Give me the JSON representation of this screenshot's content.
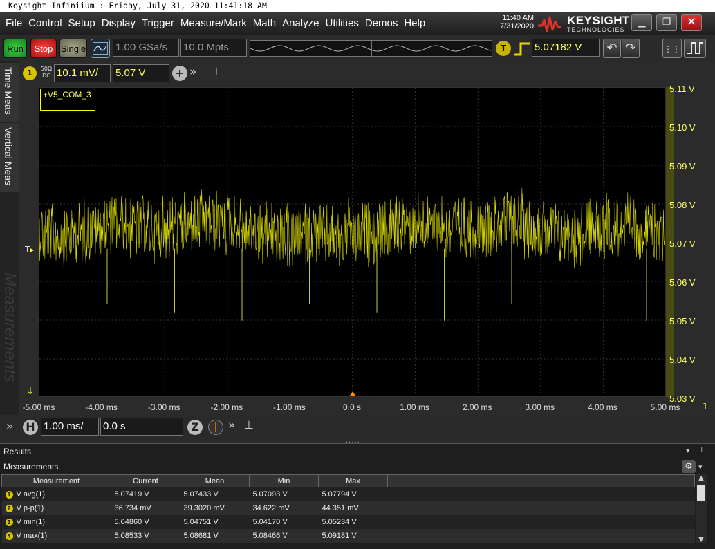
{
  "title_bar": {
    "text": "Keysight Infiniium : Friday, July 31, 2020 11:41:18 AM"
  },
  "menu": [
    "File",
    "Control",
    "Setup",
    "Display",
    "Trigger",
    "Measure/Mark",
    "Math",
    "Analyze",
    "Utilities",
    "Demos",
    "Help"
  ],
  "datetime": {
    "time": "11:40 AM",
    "date": "7/31/2020"
  },
  "brand": {
    "name": "KEYSIGHT",
    "sub": "TECHNOLOGIES"
  },
  "toolbar": {
    "run_label": "Run",
    "stop_label": "Stop",
    "single_label": "Single",
    "sample_rate": "1.00 GSa/s",
    "memory_depth": "10.0 Mpts",
    "trigger_badge": "T",
    "trigger_level": "5.07182 V"
  },
  "side_tabs": [
    "Time Meas",
    "Vertical Meas",
    "Measurements"
  ],
  "channel": {
    "number": "1",
    "impedance": "50Ω",
    "coupling": "DC",
    "scale": "10.1 mV/",
    "offset": "5.07 V",
    "label": "+V5_COM_3"
  },
  "horizontal": {
    "badge": "H",
    "scale": "1.00 ms/",
    "position": "0.0 s",
    "zoom_badge": "Z"
  },
  "markers": {
    "trigger": "T",
    "ground": "↓",
    "channel_index": "1"
  },
  "chart_data": {
    "type": "line",
    "y_tick_labels": [
      "5.11 V",
      "5.10 V",
      "5.09 V",
      "5.08 V",
      "5.07 V",
      "5.06 V",
      "5.05 V",
      "5.04 V",
      "5.03 V"
    ],
    "x_tick_labels": [
      "-5.00 ms",
      "-4.00 ms",
      "-3.00 ms",
      "-2.00 ms",
      "-1.00 ms",
      "0.0 s",
      "1.00 ms",
      "2.00 ms",
      "3.00 ms",
      "4.00 ms",
      "5.00 ms"
    ],
    "xlim": [
      -0.005,
      0.005
    ],
    "ylim": [
      5.0305,
      5.1105
    ],
    "grid": true,
    "trace_color": "#ffff00",
    "series": [
      {
        "mean_level": 5.0743,
        "band_min": 5.0647,
        "band_max": 5.0835
      }
    ]
  },
  "results": {
    "panel_title": "Results",
    "tab_title": "Measurements",
    "columns": [
      "Measurement",
      "Current",
      "Mean",
      "Min",
      "Max"
    ],
    "rows": [
      {
        "idx": "1",
        "name": "V avg(1)",
        "current": "5.07419 V",
        "mean": "5.07433 V",
        "min": "5.07093 V",
        "max": "5.07794 V"
      },
      {
        "idx": "2",
        "name": "V p-p(1)",
        "current": "36.734 mV",
        "mean": "39.3020 mV",
        "min": "34.622 mV",
        "max": "44.351 mV"
      },
      {
        "idx": "3",
        "name": "V min(1)",
        "current": "5.04860 V",
        "mean": "5.04751 V",
        "min": "5.04170 V",
        "max": "5.05234 V"
      },
      {
        "idx": "4",
        "name": "V max(1)",
        "current": "5.08533 V",
        "mean": "5.08681 V",
        "min": "5.08466 V",
        "max": "5.09181 V"
      }
    ]
  },
  "colors": {
    "channel1": "#ffff00",
    "run": "#33aa33",
    "stop": "#dd2222",
    "close": "#cc2222"
  }
}
